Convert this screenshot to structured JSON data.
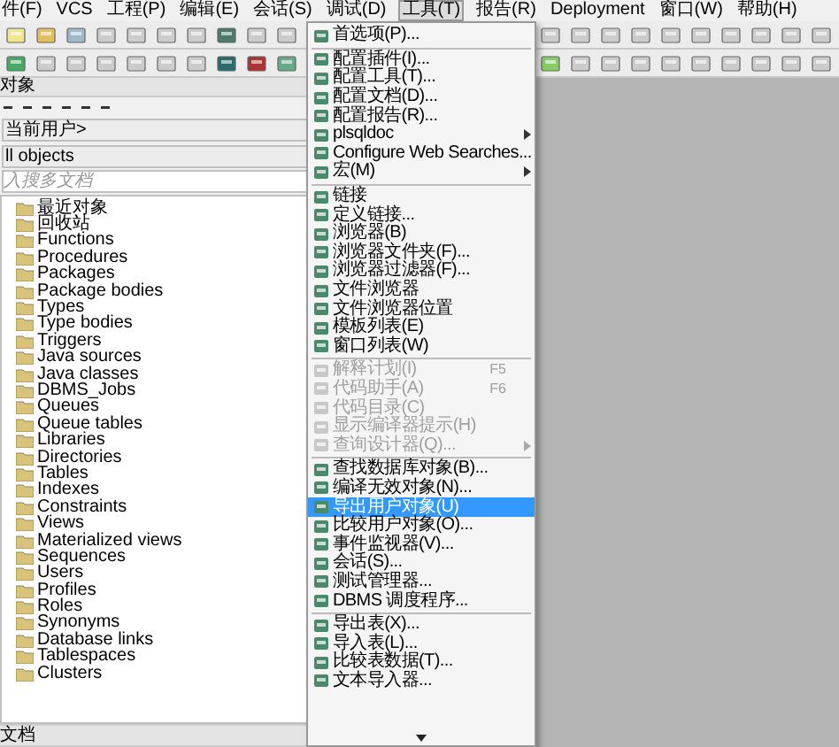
{
  "menubar": [
    {
      "label": "件(F)",
      "selected": false
    },
    {
      "label": "VCS",
      "selected": false
    },
    {
      "label": "工程(P)",
      "selected": false
    },
    {
      "label": "编辑(E)",
      "selected": false
    },
    {
      "label": "会话(S)",
      "selected": false
    },
    {
      "label": "调试(D)",
      "selected": false
    },
    {
      "label": "工具(T)",
      "selected": true
    },
    {
      "label": "报告(R)",
      "selected": false
    },
    {
      "label": "Deployment",
      "selected": false
    },
    {
      "label": "窗口(W)",
      "selected": false
    },
    {
      "label": "帮助(H)",
      "selected": false
    }
  ],
  "object_panel": {
    "title": "对象",
    "user_select": "当前用户>",
    "filter_select": "ll objects",
    "search": {
      "placeholder": "入搜多文档"
    },
    "tree": [
      {
        "label": "最近对象"
      },
      {
        "label": "回收站"
      },
      {
        "label": "Functions"
      },
      {
        "label": "Procedures"
      },
      {
        "label": "Packages"
      },
      {
        "label": "Package bodies"
      },
      {
        "label": "Types"
      },
      {
        "label": "Type bodies"
      },
      {
        "label": "Triggers"
      },
      {
        "label": "Java sources"
      },
      {
        "label": "Java classes"
      },
      {
        "label": "DBMS_Jobs"
      },
      {
        "label": "Queues"
      },
      {
        "label": "Queue tables"
      },
      {
        "label": "Libraries"
      },
      {
        "label": "Directories"
      },
      {
        "label": "Tables"
      },
      {
        "label": "Indexes"
      },
      {
        "label": "Constraints"
      },
      {
        "label": "Views"
      },
      {
        "label": "Materialized views"
      },
      {
        "label": "Sequences"
      },
      {
        "label": "Users"
      },
      {
        "label": "Profiles"
      },
      {
        "label": "Roles"
      },
      {
        "label": "Synonyms"
      },
      {
        "label": "Database links"
      },
      {
        "label": "Tablespaces"
      },
      {
        "label": "Clusters"
      }
    ]
  },
  "document_panel": {
    "title": "文档"
  },
  "tools_menu": [
    {
      "kind": "item",
      "label": "首选项(P)...",
      "disabled": false,
      "selected": false
    },
    {
      "kind": "separator"
    },
    {
      "kind": "item",
      "label": "配置插件(I)...",
      "disabled": false,
      "selected": false
    },
    {
      "kind": "item",
      "label": "配置工具(T)...",
      "disabled": false,
      "selected": false
    },
    {
      "kind": "item",
      "label": "配置文档(D)...",
      "disabled": false,
      "selected": false
    },
    {
      "kind": "item",
      "label": "配置报告(R)...",
      "disabled": false,
      "selected": false
    },
    {
      "kind": "submenu",
      "label": "plsqldoc",
      "disabled": false,
      "selected": false
    },
    {
      "kind": "item",
      "label": "Configure Web Searches...",
      "disabled": false,
      "selected": false
    },
    {
      "kind": "submenu",
      "label": "宏(M)",
      "disabled": false,
      "selected": false
    },
    {
      "kind": "separator"
    },
    {
      "kind": "item",
      "label": "链接",
      "disabled": false,
      "selected": false
    },
    {
      "kind": "item",
      "label": "定义链接...",
      "disabled": false,
      "selected": false
    },
    {
      "kind": "item",
      "label": "浏览器(B)",
      "disabled": false,
      "selected": false
    },
    {
      "kind": "item",
      "label": "浏览器文件夹(F)...",
      "disabled": false,
      "selected": false
    },
    {
      "kind": "item",
      "label": "浏览器过滤器(F)...",
      "disabled": false,
      "selected": false
    },
    {
      "kind": "item",
      "label": "文件浏览器",
      "disabled": false,
      "selected": false
    },
    {
      "kind": "item",
      "label": "文件浏览器位置",
      "disabled": false,
      "selected": false
    },
    {
      "kind": "item",
      "label": "模板列表(E)",
      "disabled": false,
      "selected": false
    },
    {
      "kind": "item",
      "label": "窗口列表(W)",
      "disabled": false,
      "selected": false
    },
    {
      "kind": "separator"
    },
    {
      "kind": "item",
      "label": "解释计划(I)",
      "shortcut": "F5",
      "disabled": true,
      "selected": false
    },
    {
      "kind": "item",
      "label": "代码助手(A)",
      "shortcut": "F6",
      "disabled": true,
      "selected": false
    },
    {
      "kind": "item",
      "label": "代码目录(C)",
      "disabled": true,
      "selected": false
    },
    {
      "kind": "item",
      "label": "显示编译器提示(H)",
      "disabled": true,
      "selected": false
    },
    {
      "kind": "submenu",
      "label": "查询设计器(Q)...",
      "disabled": true,
      "selected": false
    },
    {
      "kind": "separator"
    },
    {
      "kind": "item",
      "label": "查找数据库对象(B)...",
      "disabled": false,
      "selected": false
    },
    {
      "kind": "item",
      "label": "编译无效对象(N)...",
      "disabled": false,
      "selected": false
    },
    {
      "kind": "item",
      "label": "导出用户对象(U)",
      "disabled": false,
      "selected": true
    },
    {
      "kind": "item",
      "label": "比较用户对象(O)...",
      "disabled": false,
      "selected": false
    },
    {
      "kind": "item",
      "label": "事件监视器(V)...",
      "disabled": false,
      "selected": false
    },
    {
      "kind": "item",
      "label": "会话(S)...",
      "disabled": false,
      "selected": false
    },
    {
      "kind": "item",
      "label": "测试管理器...",
      "disabled": false,
      "selected": false
    },
    {
      "kind": "item",
      "label": "DBMS 调度程序...",
      "disabled": false,
      "selected": false
    },
    {
      "kind": "separator"
    },
    {
      "kind": "item",
      "label": "导出表(X)...",
      "disabled": false,
      "selected": false
    },
    {
      "kind": "item",
      "label": "导入表(L)...",
      "disabled": false,
      "selected": false
    },
    {
      "kind": "item",
      "label": "比较表数据(T)...",
      "disabled": false,
      "selected": false
    },
    {
      "kind": "item",
      "label": "文本导入器...",
      "disabled": false,
      "selected": false
    }
  ]
}
